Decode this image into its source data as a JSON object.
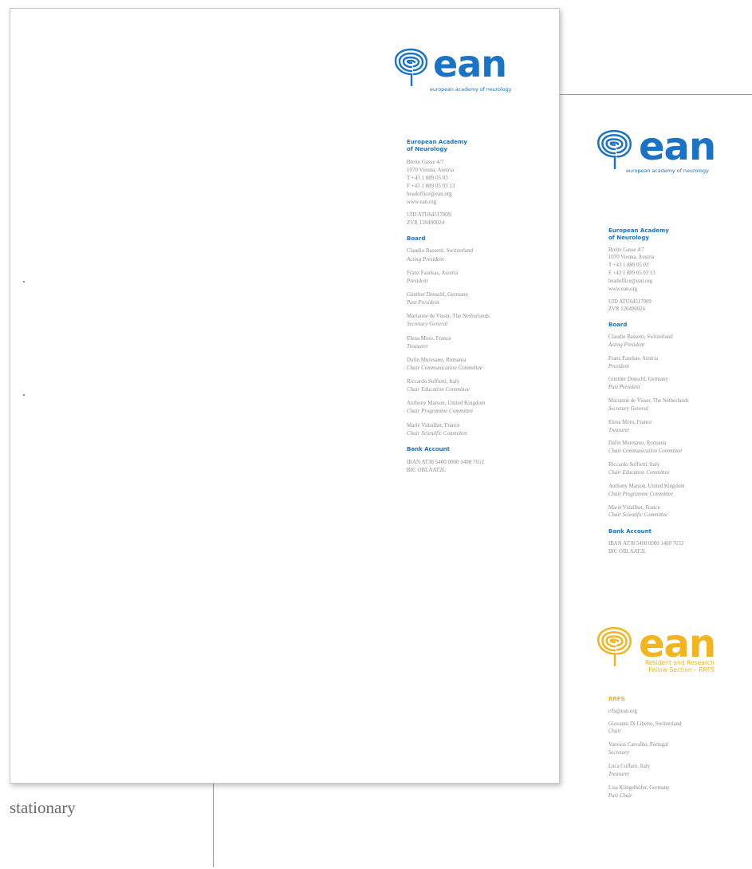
{
  "caption": "stationary",
  "colors": {
    "ean_blue": "#1a73c6",
    "rrfs_yellow": "#f2b51e"
  },
  "logo": {
    "wordmark": "ean",
    "tagline": "european academy of neurology",
    "icon": "labyrinth-brain-icon"
  },
  "rrfs_logo": {
    "wordmark": "ean",
    "tagline_line1": "Resident and Research",
    "tagline_line2": "Fellow Section – RRFS",
    "icon": "labyrinth-brain-icon"
  },
  "org": {
    "heading_line1": "European Academy",
    "heading_line2": "of Neurology",
    "address1": "Breite Gasse 4/7",
    "address2": "1070 Vienna, Austria",
    "phone": "T  +43 1 889 05 03",
    "fax": "F  +43 1 889 05 03 13",
    "email": "headoffice@ean.org",
    "web": "www.ean.org",
    "uid": "UID ATU64517909",
    "zvr": "ZVR 120490024"
  },
  "board": {
    "heading": "Board",
    "members": [
      {
        "name": "Claudio Bassetti, Switzerland",
        "role": "Acting President"
      },
      {
        "name": "Franz Fazekas, Austria",
        "role": "President"
      },
      {
        "name": "Günther Deuschl, Germany",
        "role": "Past President"
      },
      {
        "name": "Marianne de Visser, The Netherlands",
        "role": "Secretary General"
      },
      {
        "name": "Elena Moro, France",
        "role": "Treasurer"
      },
      {
        "name": "Dafin Muresanu, Romania",
        "role": "Chair Communication Committee"
      },
      {
        "name": "Riccardo Soffietti, Italy",
        "role": "Chair Education Committee"
      },
      {
        "name": "Anthony Marson, United Kingdom",
        "role": "Chair Programme Committee"
      },
      {
        "name": "Marie Vidailhet, France",
        "role": "Chair Scientific Committee"
      }
    ]
  },
  "bank": {
    "heading": "Bank Account",
    "iban": "IBAN AT38 5400 0000 1400 7652",
    "bic": "BIC OBLAAT2L"
  },
  "rrfs": {
    "heading": "RRFS",
    "email": "rrfs@ean.org",
    "members": [
      {
        "name": "Giovanni Di Liberto, Switzerland",
        "role": "Chair"
      },
      {
        "name": "Vanessa Carvalho, Portugal",
        "role": "Secretary"
      },
      {
        "name": "Luca Cuffaro, Italy",
        "role": "Treasurer"
      },
      {
        "name": "Lisa Klingelhöfer, Germany",
        "role": "Past Chair"
      }
    ]
  }
}
